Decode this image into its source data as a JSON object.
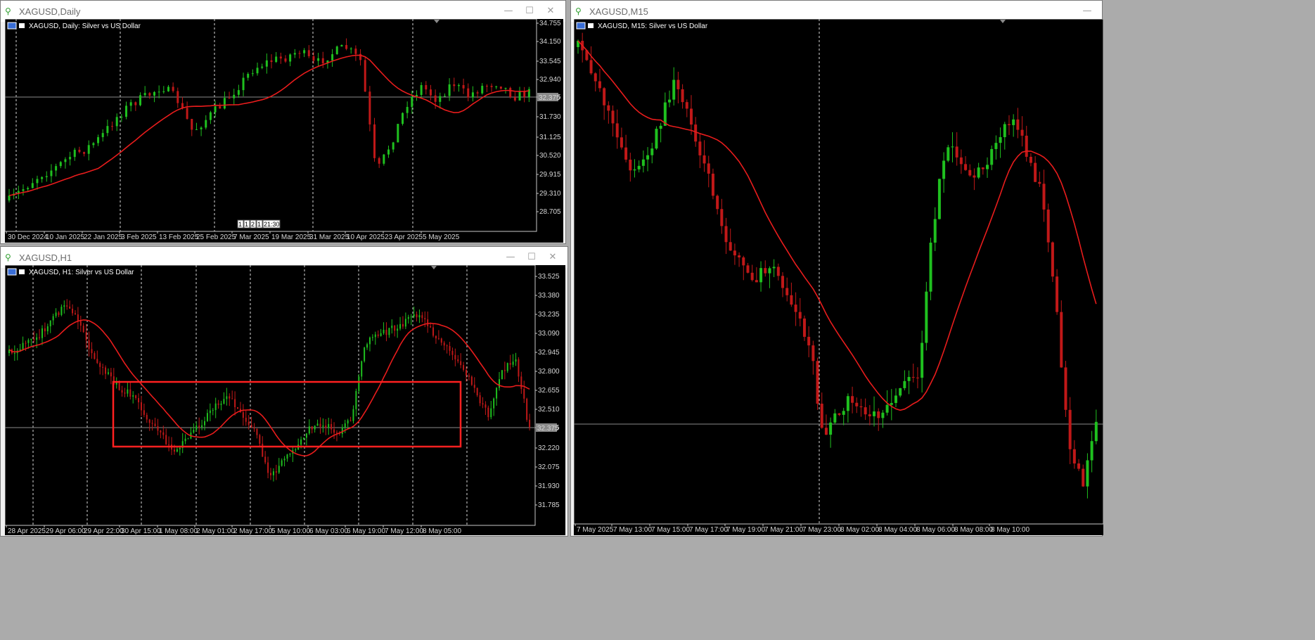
{
  "windows": {
    "daily": {
      "title": "XAGUSD,Daily",
      "chart_label": "XAGUSD, Daily:  Silver vs US Dollar",
      "prices": [
        "34.755",
        "34.150",
        "33.545",
        "32.940",
        "32.375",
        "31.730",
        "31.125",
        "30.520",
        "29.915",
        "29.310",
        "28.705"
      ],
      "dates": [
        "30 Dec 2024",
        "10 Jan 2025",
        "22 Jan 2025",
        "3 Feb 2025",
        "13 Feb 2025",
        "25 Feb 2025",
        "7 Mar 2025",
        "19 Mar 2025",
        "31 Mar 2025",
        "10 Apr 2025",
        "23 Apr 2025",
        "5 May 2025"
      ],
      "current_price": "32.375",
      "cursor_readout": [
        "1",
        "1",
        "2",
        "1",
        "21:30"
      ]
    },
    "h1": {
      "title": "XAGUSD,H1",
      "chart_label": "XAGUSD, H1:  Silver vs US Dollar",
      "prices": [
        "33.525",
        "33.380",
        "33.235",
        "33.090",
        "32.945",
        "32.800",
        "32.655",
        "32.510",
        "32.375",
        "32.220",
        "32.075",
        "31.930",
        "31.785"
      ],
      "dates": [
        "28 Apr 2025",
        "29 Apr 06:00",
        "29 Apr 22:00",
        "30 Apr 15:00",
        "1 May 08:00",
        "2 May 01:00",
        "2 May 17:00",
        "5 May 10:00",
        "6 May 03:00",
        "6 May 19:00",
        "7 May 12:00",
        "8 May 05:00"
      ],
      "current_price": "32.375"
    },
    "m15": {
      "title": "XAGUSD,M15",
      "chart_label": "XAGUSD, M15:  Silver vs US Dollar",
      "dates": [
        "7 May 2025",
        "7 May 13:00",
        "7 May 15:00",
        "7 May 17:00",
        "7 May 19:00",
        "7 May 21:00",
        "7 May 23:00",
        "8 May 02:00",
        "8 May 04:00",
        "8 May 06:00",
        "8 May 08:00",
        "8 May 10:00"
      ]
    }
  },
  "controls": {
    "minimize": "—",
    "maximize": "☐",
    "close": "✕"
  },
  "colors": {
    "bull": "#1fc01f",
    "bear": "#c01818",
    "ma": "#e81c1c",
    "box": "#ff2020",
    "grid": "#d0d0d0",
    "bg": "#000000"
  }
}
